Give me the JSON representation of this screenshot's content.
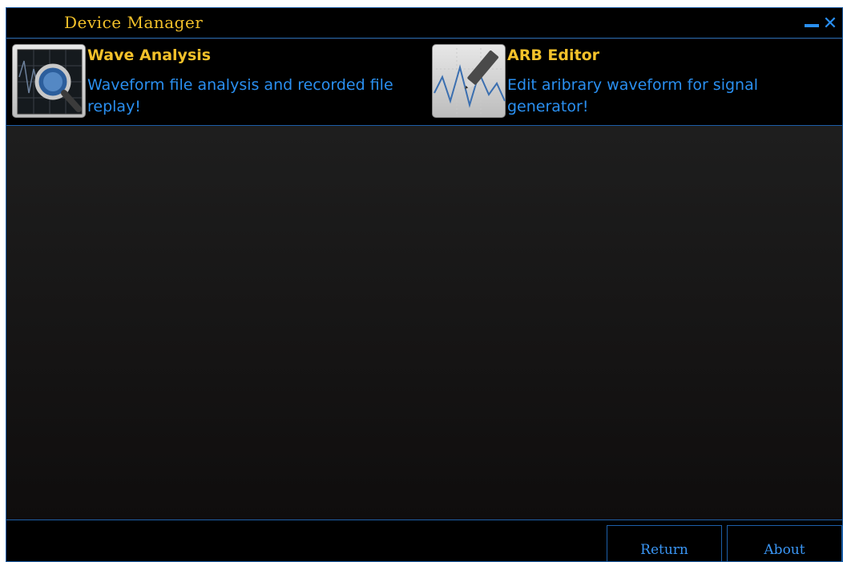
{
  "window": {
    "title": "Device Manager"
  },
  "title_controls": {
    "minimize_icon": "minimize-icon",
    "close_icon": "close-icon",
    "close_glyph": "✕"
  },
  "apps": [
    {
      "title": "Wave Analysis",
      "description": "Waveform file analysis and recorded file replay!",
      "icon": "wave-analysis-icon"
    },
    {
      "title": "ARB Editor",
      "description": "Edit aribrary waveform for signal generator!",
      "icon": "arb-editor-icon"
    }
  ],
  "footer": {
    "return_label": "Return",
    "about_label": "About"
  },
  "colors": {
    "accent": "#f3c12a",
    "link": "#2a8ff0",
    "border": "#1d5fa8",
    "background": "#1c1c1c"
  }
}
